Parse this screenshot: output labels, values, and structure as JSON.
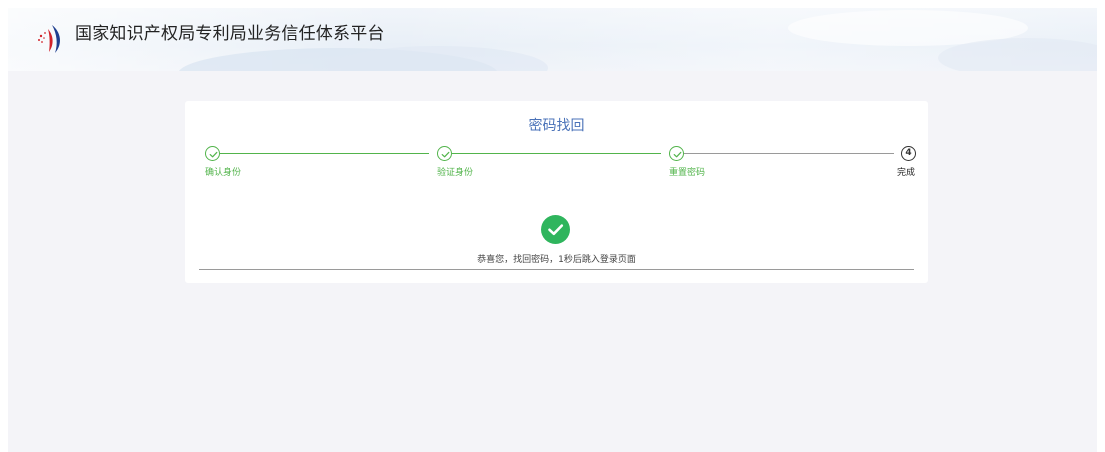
{
  "header": {
    "site_title": "国家知识产权局专利局业务信任体系平台",
    "logo_icon": "cnipa-logo-icon"
  },
  "card": {
    "title": "密码找回",
    "steps": [
      {
        "label": "确认身份",
        "status": "done",
        "icon": "check-circle-icon"
      },
      {
        "label": "验证身份",
        "status": "done",
        "icon": "check-circle-icon"
      },
      {
        "label": "重置密码",
        "status": "done",
        "icon": "check-circle-icon"
      },
      {
        "label": "完成",
        "status": "current",
        "number": "4"
      }
    ],
    "success_icon": "success-check-icon",
    "message": "恭喜您，找回密码，1秒后跳入登录页面"
  },
  "colors": {
    "accent_blue": "#4a72b8",
    "step_done": "#52b44b",
    "success": "#2fb55d",
    "page_bg": "#f4f4f8"
  }
}
